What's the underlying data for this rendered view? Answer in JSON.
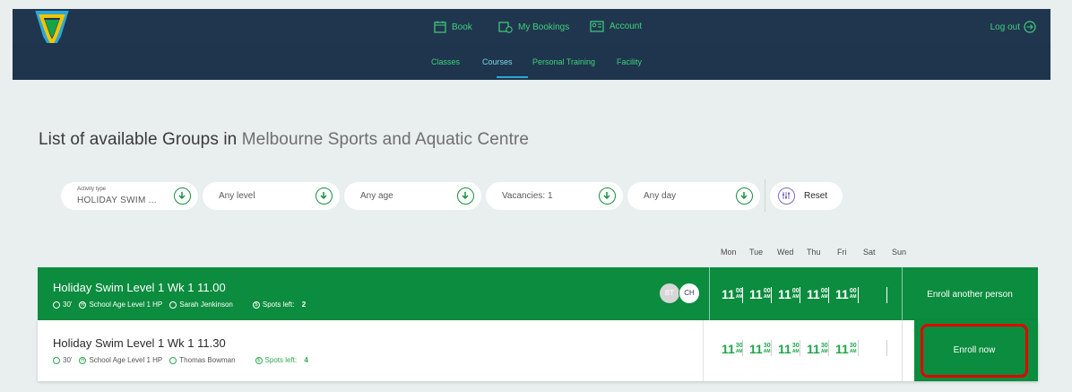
{
  "header": {
    "nav": [
      {
        "label": "Book",
        "icon": "calendar-icon"
      },
      {
        "label": "My Bookings",
        "icon": "calendar-clock-icon"
      },
      {
        "label": "Account",
        "icon": "id-card-icon"
      }
    ],
    "logout_label": "Log out",
    "subnav": [
      "Classes",
      "Courses",
      "Personal Training",
      "Facility"
    ],
    "active_subnav": "Courses"
  },
  "title": {
    "prefix": "List of available Groups in",
    "venue": "Melbourne Sports and Aquatic Centre"
  },
  "filters": {
    "activity_caption": "Activity type",
    "activity_value": "HOLIDAY SWIM ...",
    "level": "Any level",
    "age": "Any age",
    "vacancies": "Vacancies: 1",
    "day": "Any day",
    "reset": "Reset"
  },
  "days": [
    "Mon",
    "Tue",
    "Wed",
    "Thu",
    "Fri",
    "Sat",
    "Sun"
  ],
  "groups": [
    {
      "title": "Holiday Swim Level 1 Wk 1 11.00",
      "duration": "30'",
      "level": "School Age Level 1 HP",
      "instructor": "Sarah Jenkinson",
      "spots_label": "Spots left:",
      "spots": "2",
      "avatars": [
        "BT",
        "CH"
      ],
      "times": [
        {
          "h": "11",
          "m": "00",
          "ap": "AM"
        },
        {
          "h": "11",
          "m": "00",
          "ap": "AM"
        },
        {
          "h": "11",
          "m": "00",
          "ap": "AM"
        },
        {
          "h": "11",
          "m": "00",
          "ap": "AM"
        },
        {
          "h": "11",
          "m": "00",
          "ap": "AM"
        }
      ],
      "action": "Enroll another person"
    },
    {
      "title": "Holiday Swim Level 1 Wk 1 11.30",
      "duration": "30'",
      "level": "School Age Level 1 HP",
      "instructor": "Thomas Bowman",
      "spots_label": "Spots left:",
      "spots": "4",
      "times": [
        {
          "h": "11",
          "m": "30",
          "ap": "AM"
        },
        {
          "h": "11",
          "m": "30",
          "ap": "AM"
        },
        {
          "h": "11",
          "m": "30",
          "ap": "AM"
        },
        {
          "h": "11",
          "m": "30",
          "ap": "AM"
        },
        {
          "h": "11",
          "m": "30",
          "ap": "AM"
        }
      ],
      "action": "Enroll now"
    }
  ],
  "colors": {
    "header_bg": "#20364f",
    "accent_green": "#0b8c3e",
    "nav_green": "#3fd17a",
    "highlight_red": "#e30000"
  }
}
